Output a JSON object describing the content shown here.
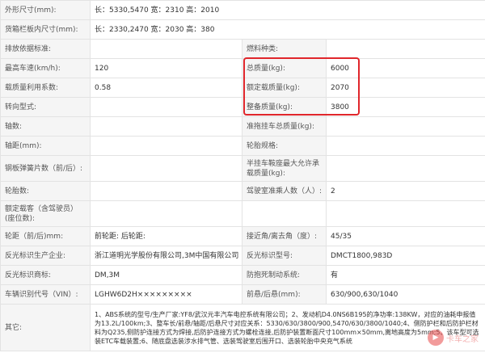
{
  "rows": [
    {
      "l1": "外形尺寸(mm):",
      "v1": "长：5330,5470 宽：2310 高：2010"
    },
    {
      "l1": "货箱栏板内尺寸(mm):",
      "v1": "长：2330,2470 宽：2030 高：380"
    },
    {
      "l1": "排放依据标准:",
      "v1": "",
      "l2": "燃料种类:",
      "v2": ""
    },
    {
      "l1": "最高车速(km/h):",
      "v1": "120",
      "l2": "总质量(kg):",
      "v2": "6000"
    },
    {
      "l1": "载质量利用系数:",
      "v1": "0.58",
      "l2": "额定载质量(kg):",
      "v2": "2070"
    },
    {
      "l1": "转向型式:",
      "v1": "",
      "l2": "整备质量(kg):",
      "v2": "3800"
    },
    {
      "l1": "轴数:",
      "v1": "",
      "l2": "准拖挂车总质量(kg):",
      "v2": ""
    },
    {
      "l1": "轴距(mm):",
      "v1": "",
      "l2": "轮胎规格:",
      "v2": ""
    },
    {
      "l1": "钢板弹簧片数（前/后）:",
      "v1": "",
      "l2": "半挂车鞍座最大允许承载质量(kg):",
      "v2": ""
    },
    {
      "l1": "轮胎数:",
      "v1": "",
      "l2": "驾驶室准乘人数（人）:",
      "v2": "2"
    },
    {
      "l1": "额定载客（含驾驶员）(座位数):",
      "v1": "",
      "l2": "",
      "v2": ""
    },
    {
      "l1": "轮距（前/后)mm:",
      "v1": "前轮距: 后轮距:",
      "l2": "接近角/离去角（度）:",
      "v2": "45/35"
    },
    {
      "l1": "反光标识生产企业:",
      "v1": "浙江道明光学股份有限公司,3M中国有限公司",
      "l2": "反光标识型号:",
      "v2": "DMCT1800,983D"
    },
    {
      "l1": "反光标识商标:",
      "v1": "DM,3M",
      "l2": "防抱死制动系统:",
      "v2": "有"
    },
    {
      "l1": "车辆识别代号（VIN）:",
      "v1": "LGHW6D2H×××××××××",
      "l2": "前悬/后悬(mm):",
      "v2": "630/900,630/1040"
    },
    {
      "l1": "其它:",
      "v1": "1、ABS系统的型号/生产厂家:YF8/武汉元丰汽车电控系统有限公司；2、发动机D4.0NS6B195的净功率:138KW，对应的油耗申报值为13.2L/100km;3、整车长/前悬/轴距/后悬尺寸对应关系：5330/630/3800/900,5470/630/3800/1040;4、侧防护栏和后防护栏材料为Q235,侧防护连接方式为焊接,后防护连接方式为螺栓连接,后防护装置断面尺寸100mm×50mm,离地高度为5mm;5、该车型可选装ETC车载装置;6、随底盘选装涉水排气管、选装驾驶室后围开口、选装轮胎中央充气系统"
    }
  ],
  "watermark": {
    "text": "卡车之家"
  },
  "highlight_color": "#e0262b"
}
